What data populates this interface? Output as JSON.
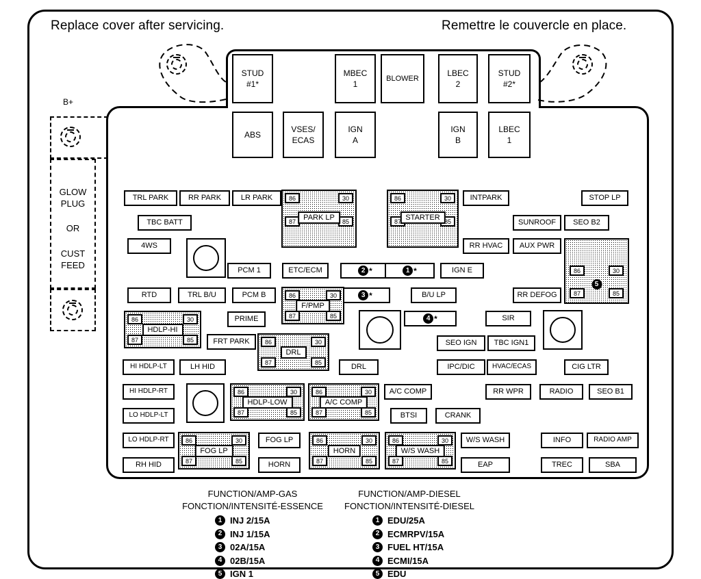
{
  "header": {
    "left_note": "Replace cover after servicing.",
    "right_note": "Remettre le couvercle en place."
  },
  "left_panel": {
    "b_plus": "B+",
    "lines": [
      "GLOW",
      "PLUG",
      "OR",
      "CUST",
      "FEED"
    ],
    "text_block": "GLOW\nPLUG\n\nOR\n\nCUST\nFEED"
  },
  "top_cartridges_row1": [
    {
      "label": "STUD\n#1*",
      "line1": "STUD",
      "line2": "#1*"
    },
    {
      "label": "MBEC 1",
      "line1": "MBEC",
      "line2": "1"
    },
    {
      "label": "BLOWER",
      "line1": "BLOWER",
      "line2": ""
    },
    {
      "label": "LBEC 2",
      "line1": "LBEC",
      "line2": "2"
    },
    {
      "label": "STUD #2*",
      "line1": "STUD",
      "line2": "#2*"
    }
  ],
  "top_cartridges_row2": [
    {
      "label": "ABS",
      "line1": "ABS",
      "line2": ""
    },
    {
      "label": "VSES/ECAS",
      "line1": "VSES/",
      "line2": "ECAS"
    },
    {
      "label": "IGN A",
      "line1": "IGN",
      "line2": "A"
    },
    {
      "label": "IGN B",
      "line1": "IGN",
      "line2": "B"
    },
    {
      "label": "LBEC 1",
      "line1": "LBEC",
      "line2": "1"
    }
  ],
  "fuses": {
    "trl_park": "TRL PARK",
    "rr_park": "RR PARK",
    "lr_park": "LR PARK",
    "intpark": "INTPARK",
    "stop_lp": "STOP LP",
    "tbc_batt": "TBC BATT",
    "sunroof": "SUNROOF",
    "seo_b2": "SEO B2",
    "fws": "4WS",
    "rr_hvac": "RR HVAC",
    "aux_pwr": "AUX PWR",
    "pcm1": "PCM 1",
    "etc_ecm": "ETC/ECM",
    "ign_e": "IGN E",
    "rtd": "RTD",
    "trl_bu": "TRL B/U",
    "pcm_b": "PCM B",
    "bu_lp": "B/U LP",
    "rr_defog": "RR DEFOG",
    "prime": "PRIME",
    "sir": "SIR",
    "frt_park": "FRT PARK",
    "seo_ign": "SEO IGN",
    "tbc_ign1": "TBC IGN1",
    "hi_hdlp_lt": "HI HDLP-LT",
    "lh_hid": "LH HID",
    "drl_fuse": "DRL",
    "ipc_dic": "IPC/DIC",
    "hvac_ecas": "HVAC/ECAS",
    "cig_ltr": "CIG LTR",
    "hi_hdlp_rt": "HI HDLP-RT",
    "ac_comp_fuse": "A/C COMP",
    "rr_wpr": "RR WPR",
    "radio": "RADIO",
    "seo_b1": "SEO B1",
    "lo_hdlp_lt": "LO HDLP-LT",
    "btsi": "BTSI",
    "crank": "CRANK",
    "lo_hdlp_rt": "LO HDLP-RT",
    "fog_lp_fuse": "FOG LP",
    "ws_wash_fuse": "W/S WASH",
    "info": "INFO",
    "radio_amp": "RADIO AMP",
    "rh_hid": "RH HID",
    "horn_fuse": "HORN",
    "eap": "EAP",
    "trec": "TREC",
    "sba": "SBA"
  },
  "relays": {
    "park_lp": "PARK LP",
    "starter": "STARTER",
    "f_pmp": "F/PMP",
    "hdlp_hi": "HDLP-HI",
    "drl": "DRL",
    "hdlp_low": "HDLP-LOW",
    "ac_comp": "A/C COMP",
    "fog_lp": "FOG LP",
    "horn": "HORN",
    "ws_wash": "W/S WASH",
    "terminals": {
      "t86": "86",
      "t30": "30",
      "t87": "87",
      "t85": "85"
    }
  },
  "numbered_fuses": [
    {
      "num": "2",
      "star": "*"
    },
    {
      "num": "1",
      "star": "*"
    },
    {
      "num": "3",
      "star": "*"
    },
    {
      "num": "4",
      "star": "*"
    },
    {
      "num": "5",
      "star": ""
    }
  ],
  "legend": {
    "gas": {
      "title_en": "FUNCTION/AMP-GAS",
      "title_fr": "FONCTION/INTENSITÉ-ESSENCE",
      "items": [
        {
          "num": "1",
          "text": "INJ 2/15A"
        },
        {
          "num": "2",
          "text": "INJ 1/15A"
        },
        {
          "num": "3",
          "text": "02A/15A"
        },
        {
          "num": "4",
          "text": "02B/15A"
        },
        {
          "num": "5",
          "text": "IGN 1"
        }
      ]
    },
    "diesel": {
      "title_en": "FUNCTION/AMP-DIESEL",
      "title_fr": "FONCTION/INTENSITÉ-DIESEL",
      "items": [
        {
          "num": "1",
          "text": "EDU/25A"
        },
        {
          "num": "2",
          "text": "ECMRPV/15A"
        },
        {
          "num": "3",
          "text": "FUEL HT/15A"
        },
        {
          "num": "4",
          "text": "ECMI/15A"
        },
        {
          "num": "5",
          "text": "EDU"
        }
      ]
    }
  },
  "colors": {
    "line": "#000000",
    "background": "#ffffff",
    "relay_fill": "#e8e8e8"
  }
}
